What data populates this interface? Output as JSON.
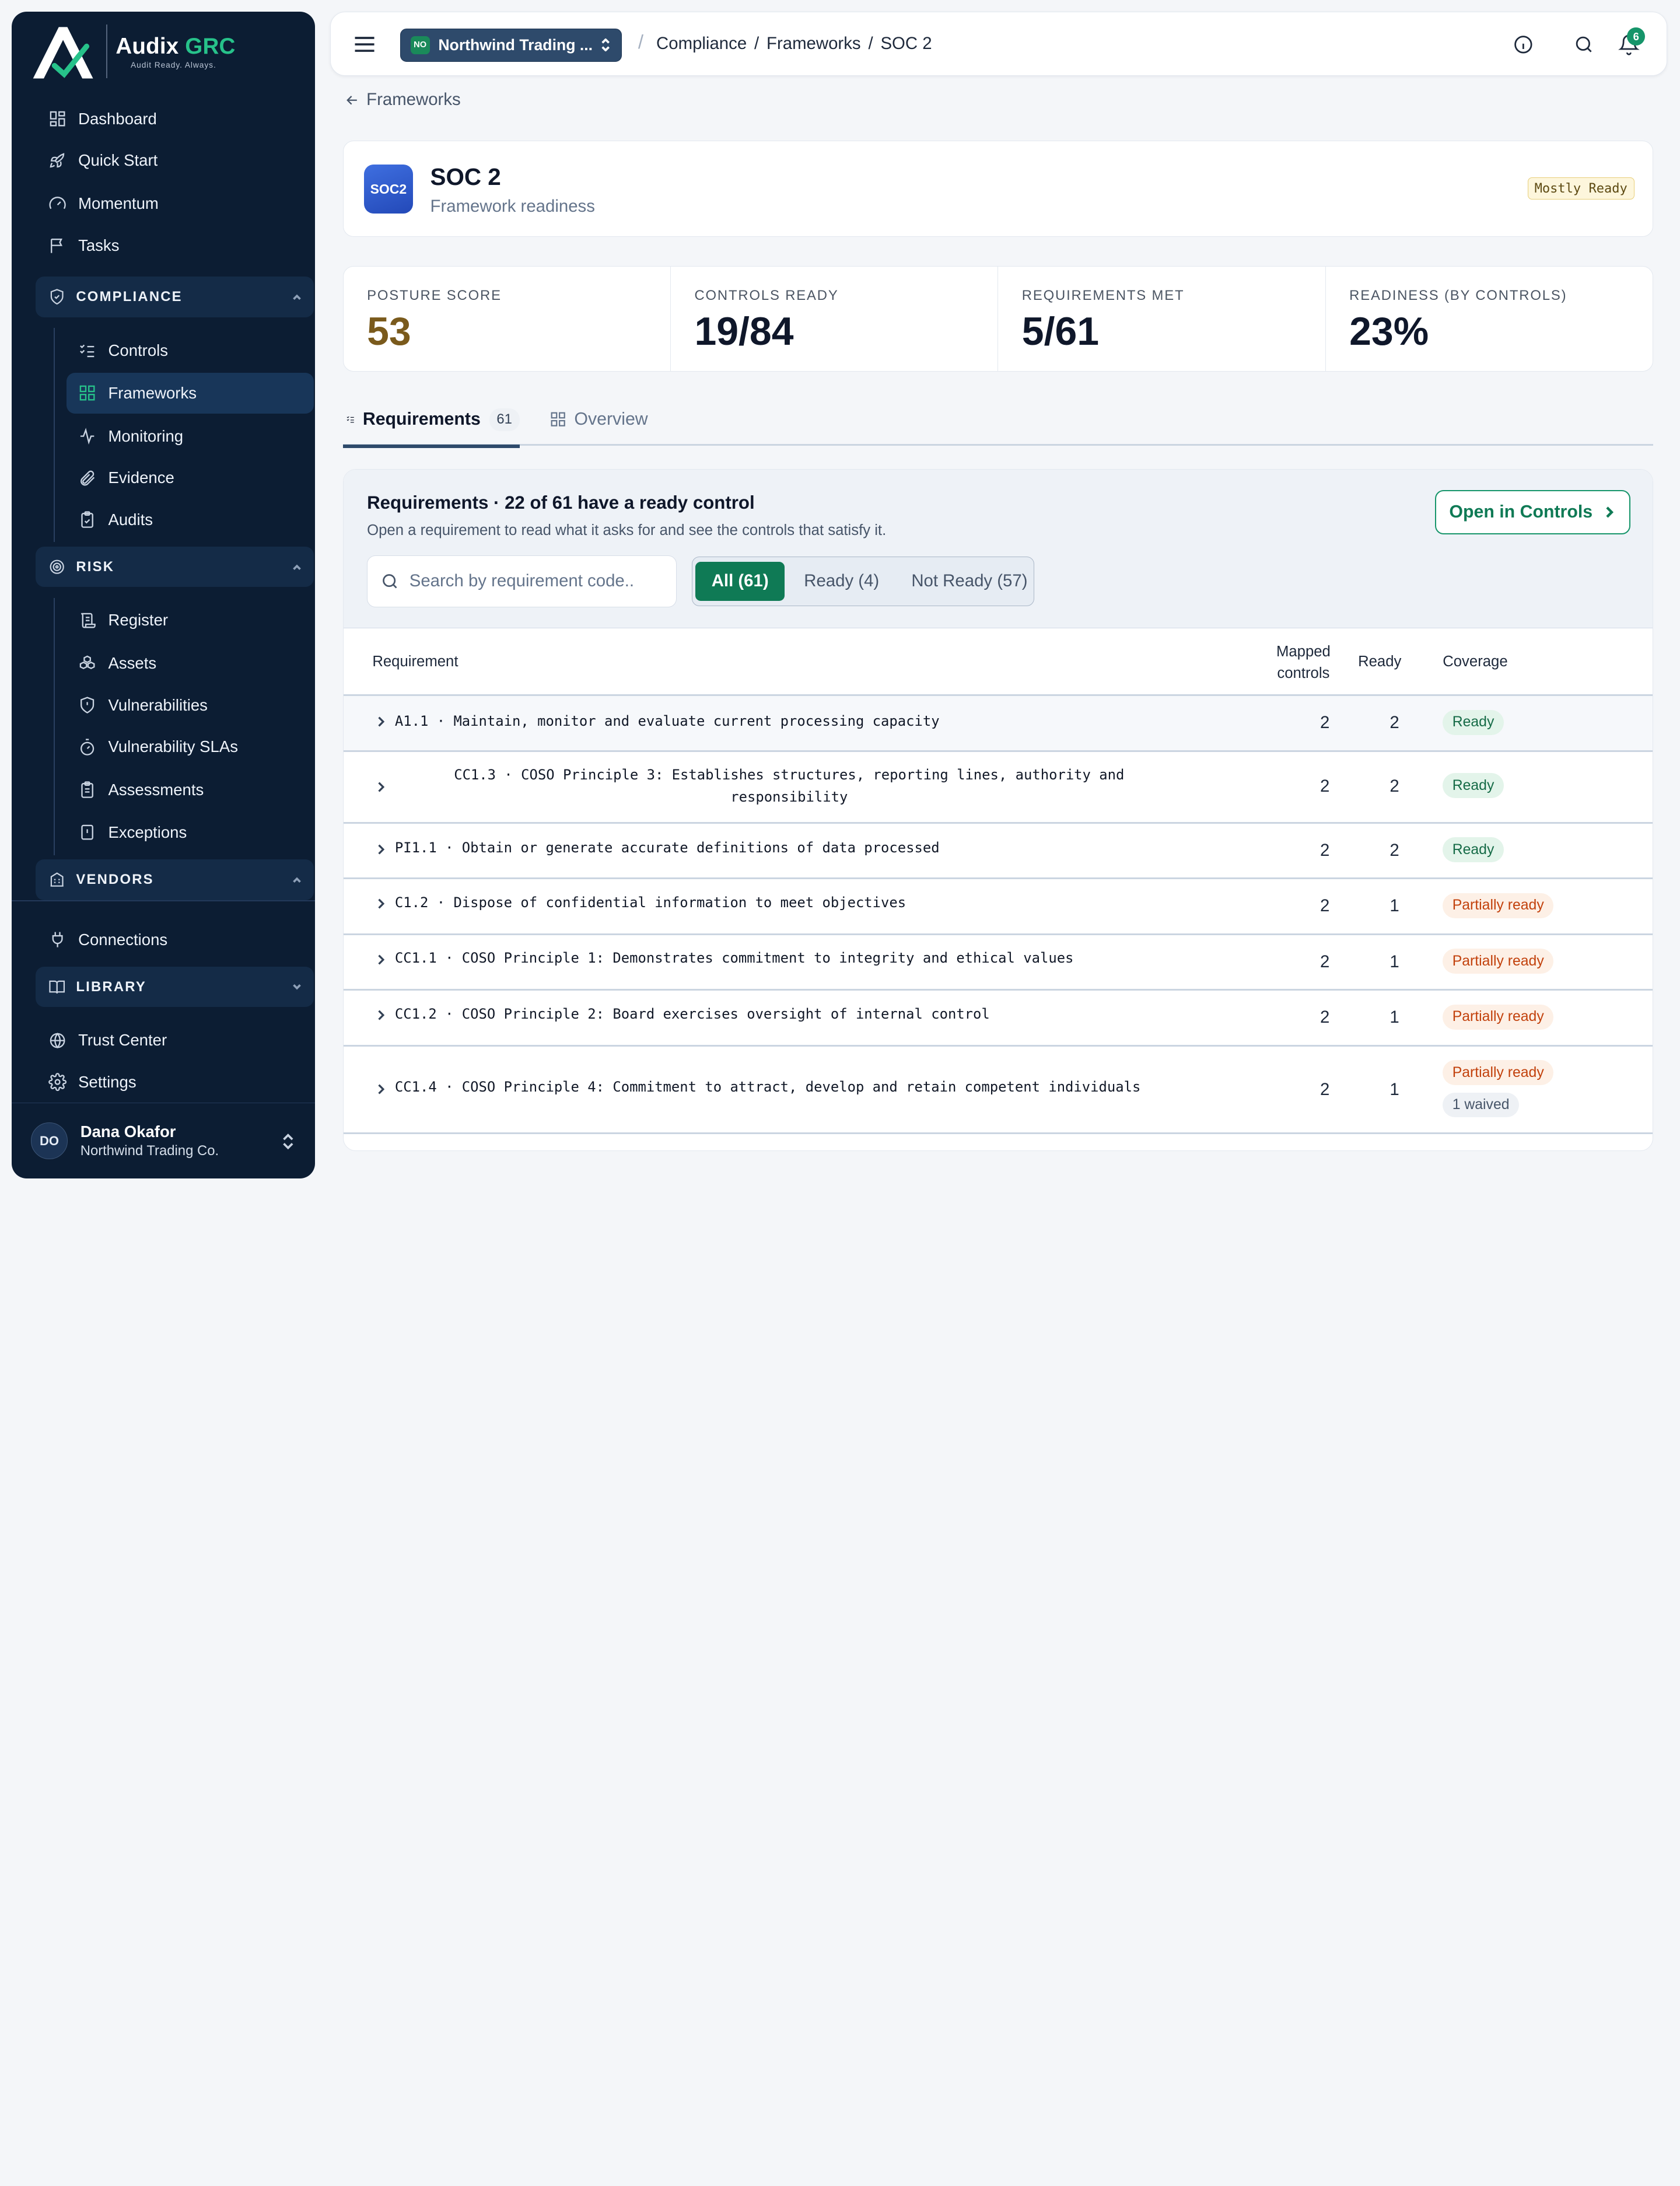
{
  "brand": {
    "name_main": "Audix",
    "name_accent": "GRC",
    "tagline": "Audit Ready. Always."
  },
  "nav": {
    "dashboard": "Dashboard",
    "quick_start": "Quick Start",
    "momentum": "Momentum",
    "tasks": "Tasks",
    "compliance": {
      "label": "COMPLIANCE",
      "items": [
        "Controls",
        "Frameworks",
        "Monitoring",
        "Evidence",
        "Audits"
      ],
      "active": "Frameworks"
    },
    "risk": {
      "label": "RISK",
      "items": [
        "Register",
        "Assets",
        "Vulnerabilities",
        "Vulnerability SLAs",
        "Assessments",
        "Exceptions"
      ]
    },
    "vendors": {
      "label": "VENDORS"
    },
    "connections": "Connections",
    "library": {
      "label": "LIBRARY"
    },
    "trust_center": "Trust Center",
    "settings": "Settings"
  },
  "user": {
    "initials": "DO",
    "name": "Dana Okafor",
    "org": "Northwind Trading Co."
  },
  "topbar": {
    "org_badge": "NO",
    "org_name": "Northwind Trading ...",
    "breadcrumb": [
      "Compliance",
      "/",
      "Frameworks",
      "/",
      "SOC 2"
    ],
    "notification_count": "6"
  },
  "back_link": "Frameworks",
  "framework": {
    "logo_text": "SOC2",
    "title": "SOC 2",
    "subtitle": "Framework readiness",
    "status_badge": "Mostly Ready"
  },
  "stats": [
    {
      "label": "POSTURE SCORE",
      "value": "53"
    },
    {
      "label": "CONTROLS READY",
      "value": "19/84"
    },
    {
      "label": "REQUIREMENTS MET",
      "value": "5/61"
    },
    {
      "label": "READINESS (BY CONTROLS)",
      "value": "23%"
    }
  ],
  "tabs": [
    {
      "label": "Requirements",
      "count": "61",
      "active": true
    },
    {
      "label": "Overview",
      "active": false
    }
  ],
  "requirements": {
    "title": "Requirements · 22 of 61 have a ready control",
    "description": "Open a requirement to read what it asks for and see the controls that satisfy it.",
    "open_button": "Open in Controls",
    "search_placeholder": "Search by requirement code..",
    "filters": [
      "All (61)",
      "Ready (4)",
      "Not Ready (57)"
    ],
    "active_filter": "All (61)",
    "columns": {
      "requirement": "Requirement",
      "mapped_1": "Mapped",
      "mapped_2": "controls",
      "ready": "Ready",
      "coverage": "Coverage"
    },
    "rows": [
      {
        "text": "A1.1 · Maintain, monitor and evaluate current processing capacity",
        "mapped": "2",
        "ready": "2",
        "coverage": "Ready"
      },
      {
        "text": "CC1.3 · COSO Principle 3: Establishes structures, reporting lines, authority and responsibility",
        "mapped": "2",
        "ready": "2",
        "coverage": "Ready"
      },
      {
        "text": "PI1.1 · Obtain or generate accurate definitions of data processed",
        "mapped": "2",
        "ready": "2",
        "coverage": "Ready"
      },
      {
        "text": "C1.2 · Dispose of confidential information to meet objectives",
        "mapped": "2",
        "ready": "1",
        "coverage": "Partially ready"
      },
      {
        "text": "CC1.1 · COSO Principle 1: Demonstrates commitment to integrity and ethical values",
        "mapped": "2",
        "ready": "1",
        "coverage": "Partially ready"
      },
      {
        "text": "CC1.2 · COSO Principle 2: Board exercises oversight of internal control",
        "mapped": "2",
        "ready": "1",
        "coverage": "Partially ready"
      },
      {
        "text": "CC1.4 · COSO Principle 4: Commitment to attract, develop and retain competent individuals",
        "mapped": "2",
        "ready": "1",
        "coverage": "Partially ready",
        "extra": "1 waived"
      }
    ]
  },
  "colors": {
    "sidebar_bg": "#0c1d33",
    "accent_green": "#16956a",
    "ready_bg": "#e3f4ea",
    "partial_text": "#c2410c"
  }
}
